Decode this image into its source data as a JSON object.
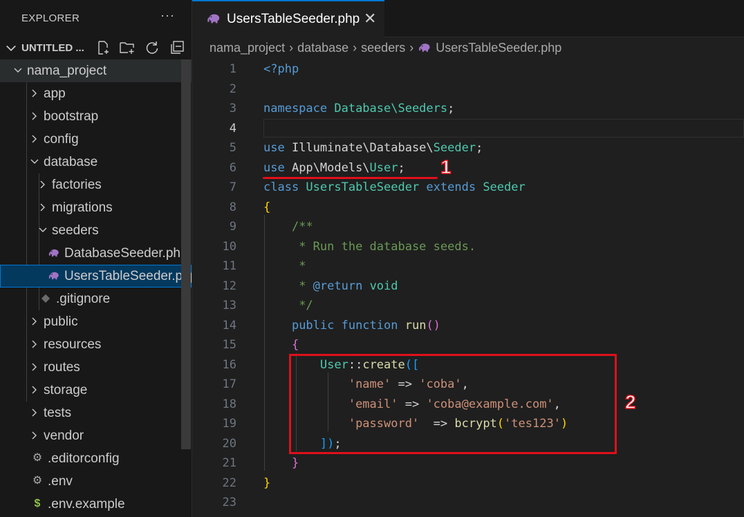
{
  "explorer": {
    "title": "EXPLORER",
    "more": "···",
    "workspace_title": "UNTITLED ...",
    "workspace_actions": [
      "new-file-icon",
      "new-folder-icon",
      "refresh-icon",
      "collapse-all-icon"
    ],
    "tree": [
      {
        "label": "nama_project",
        "type": "folder",
        "expanded": true
      },
      {
        "label": "app",
        "type": "folder",
        "expanded": false
      },
      {
        "label": "bootstrap",
        "type": "folder",
        "expanded": false
      },
      {
        "label": "config",
        "type": "folder",
        "expanded": false
      },
      {
        "label": "database",
        "type": "folder",
        "expanded": true
      },
      {
        "label": "factories",
        "type": "folder",
        "expanded": false
      },
      {
        "label": "migrations",
        "type": "folder",
        "expanded": false
      },
      {
        "label": "seeders",
        "type": "folder",
        "expanded": true
      },
      {
        "label": "DatabaseSeeder.php",
        "type": "php-file"
      },
      {
        "label": "UsersTableSeeder.php",
        "type": "php-file",
        "selected": true
      },
      {
        "label": ".gitignore",
        "type": "git-file"
      },
      {
        "label": "public",
        "type": "folder",
        "expanded": false
      },
      {
        "label": "resources",
        "type": "folder",
        "expanded": false
      },
      {
        "label": "routes",
        "type": "folder",
        "expanded": false
      },
      {
        "label": "storage",
        "type": "folder",
        "expanded": false
      },
      {
        "label": "tests",
        "type": "folder",
        "expanded": false
      },
      {
        "label": "vendor",
        "type": "folder",
        "expanded": false
      },
      {
        "label": ".editorconfig",
        "type": "config-file"
      },
      {
        "label": ".env",
        "type": "config-file"
      },
      {
        "label": ".env.example",
        "type": "dollar-file"
      }
    ]
  },
  "tab": {
    "label": "UsersTableSeeder.php",
    "close": "✕"
  },
  "breadcrumb": [
    "nama_project",
    "database",
    "seeders",
    "UsersTableSeeder.php"
  ],
  "editor": {
    "active_line": 4,
    "lines": [
      [
        [
          "kw",
          "<?php"
        ]
      ],
      [],
      [
        [
          "kw",
          "namespace "
        ],
        [
          "ty",
          "Database\\Seeders"
        ],
        [
          "pl",
          ";"
        ]
      ],
      [],
      [
        [
          "kw",
          "use "
        ],
        [
          "pl",
          "Illuminate\\Database\\"
        ],
        [
          "ty",
          "Seeder"
        ],
        [
          "pl",
          ";"
        ]
      ],
      [
        [
          "kw",
          "use "
        ],
        [
          "pl",
          "App\\Models\\"
        ],
        [
          "ty",
          "User"
        ],
        [
          "pl",
          ";"
        ]
      ],
      [
        [
          "kw",
          "class "
        ],
        [
          "ty",
          "UsersTableSeeder "
        ],
        [
          "kw",
          "extends "
        ],
        [
          "ty",
          "Seeder"
        ]
      ],
      [
        [
          "b1",
          "{"
        ]
      ],
      [
        [
          "pl",
          "    "
        ],
        [
          "cm",
          "/**"
        ]
      ],
      [
        [
          "pl",
          "    "
        ],
        [
          "cm",
          " * Run the database seeds."
        ]
      ],
      [
        [
          "pl",
          "    "
        ],
        [
          "cm",
          " *"
        ]
      ],
      [
        [
          "pl",
          "    "
        ],
        [
          "cm",
          " * "
        ],
        [
          "cmk",
          "@return "
        ],
        [
          "cmt",
          "void"
        ]
      ],
      [
        [
          "pl",
          "    "
        ],
        [
          "cm",
          " */"
        ]
      ],
      [
        [
          "pl",
          "    "
        ],
        [
          "kw",
          "public function "
        ],
        [
          "fn",
          "run"
        ],
        [
          "b2",
          "()"
        ]
      ],
      [
        [
          "pl",
          "    "
        ],
        [
          "b2",
          "{"
        ]
      ],
      [
        [
          "pl",
          "        "
        ],
        [
          "ty",
          "User"
        ],
        [
          "pl",
          "::"
        ],
        [
          "fn",
          "create"
        ],
        [
          "b3",
          "(["
        ]
      ],
      [
        [
          "pl",
          "            "
        ],
        [
          "st",
          "'name'"
        ],
        [
          "pl",
          " => "
        ],
        [
          "st",
          "'coba'"
        ],
        [
          "pl",
          ","
        ]
      ],
      [
        [
          "pl",
          "            "
        ],
        [
          "st",
          "'email'"
        ],
        [
          "pl",
          " => "
        ],
        [
          "st",
          "'coba@example.com'"
        ],
        [
          "pl",
          ","
        ]
      ],
      [
        [
          "pl",
          "            "
        ],
        [
          "st",
          "'password'"
        ],
        [
          "pl",
          "  => "
        ],
        [
          "fn",
          "bcrypt"
        ],
        [
          "b1",
          "("
        ],
        [
          "st",
          "'tes123'"
        ],
        [
          "b1",
          ")"
        ]
      ],
      [
        [
          "pl",
          "        "
        ],
        [
          "b3",
          "])"
        ],
        [
          "pl",
          ";"
        ]
      ],
      [
        [
          "pl",
          "    "
        ],
        [
          "b2",
          "}"
        ]
      ],
      [
        [
          "b1",
          "}"
        ]
      ],
      []
    ]
  },
  "annotations": {
    "label_1": "1",
    "label_2": "2",
    "accent_color": "#e0101a"
  },
  "colors": {
    "accent": "#0078d4",
    "keyword": "#569cd6",
    "type": "#4ec9b0",
    "function": "#dcdcaa",
    "string": "#ce9178",
    "comment": "#6a9955"
  }
}
